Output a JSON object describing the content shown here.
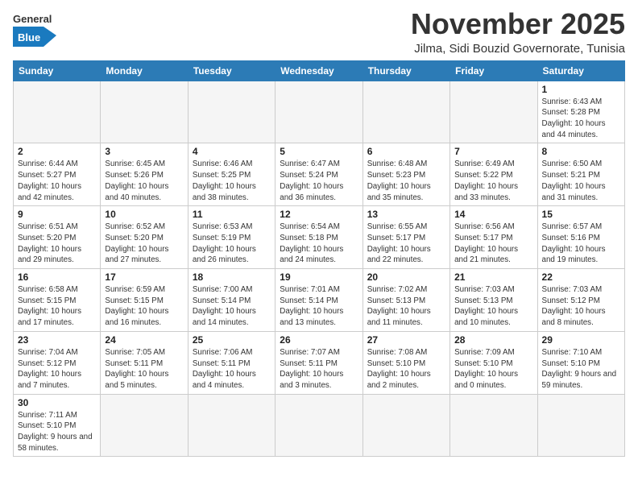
{
  "header": {
    "logo_general": "General",
    "logo_blue": "Blue",
    "month_title": "November 2025",
    "location": "Jilma, Sidi Bouzid Governorate, Tunisia"
  },
  "weekdays": [
    "Sunday",
    "Monday",
    "Tuesday",
    "Wednesday",
    "Thursday",
    "Friday",
    "Saturday"
  ],
  "weeks": [
    [
      {
        "day": "",
        "info": ""
      },
      {
        "day": "",
        "info": ""
      },
      {
        "day": "",
        "info": ""
      },
      {
        "day": "",
        "info": ""
      },
      {
        "day": "",
        "info": ""
      },
      {
        "day": "",
        "info": ""
      },
      {
        "day": "1",
        "info": "Sunrise: 6:43 AM\nSunset: 5:28 PM\nDaylight: 10 hours and 44 minutes."
      }
    ],
    [
      {
        "day": "2",
        "info": "Sunrise: 6:44 AM\nSunset: 5:27 PM\nDaylight: 10 hours and 42 minutes."
      },
      {
        "day": "3",
        "info": "Sunrise: 6:45 AM\nSunset: 5:26 PM\nDaylight: 10 hours and 40 minutes."
      },
      {
        "day": "4",
        "info": "Sunrise: 6:46 AM\nSunset: 5:25 PM\nDaylight: 10 hours and 38 minutes."
      },
      {
        "day": "5",
        "info": "Sunrise: 6:47 AM\nSunset: 5:24 PM\nDaylight: 10 hours and 36 minutes."
      },
      {
        "day": "6",
        "info": "Sunrise: 6:48 AM\nSunset: 5:23 PM\nDaylight: 10 hours and 35 minutes."
      },
      {
        "day": "7",
        "info": "Sunrise: 6:49 AM\nSunset: 5:22 PM\nDaylight: 10 hours and 33 minutes."
      },
      {
        "day": "8",
        "info": "Sunrise: 6:50 AM\nSunset: 5:21 PM\nDaylight: 10 hours and 31 minutes."
      }
    ],
    [
      {
        "day": "9",
        "info": "Sunrise: 6:51 AM\nSunset: 5:20 PM\nDaylight: 10 hours and 29 minutes."
      },
      {
        "day": "10",
        "info": "Sunrise: 6:52 AM\nSunset: 5:20 PM\nDaylight: 10 hours and 27 minutes."
      },
      {
        "day": "11",
        "info": "Sunrise: 6:53 AM\nSunset: 5:19 PM\nDaylight: 10 hours and 26 minutes."
      },
      {
        "day": "12",
        "info": "Sunrise: 6:54 AM\nSunset: 5:18 PM\nDaylight: 10 hours and 24 minutes."
      },
      {
        "day": "13",
        "info": "Sunrise: 6:55 AM\nSunset: 5:17 PM\nDaylight: 10 hours and 22 minutes."
      },
      {
        "day": "14",
        "info": "Sunrise: 6:56 AM\nSunset: 5:17 PM\nDaylight: 10 hours and 21 minutes."
      },
      {
        "day": "15",
        "info": "Sunrise: 6:57 AM\nSunset: 5:16 PM\nDaylight: 10 hours and 19 minutes."
      }
    ],
    [
      {
        "day": "16",
        "info": "Sunrise: 6:58 AM\nSunset: 5:15 PM\nDaylight: 10 hours and 17 minutes."
      },
      {
        "day": "17",
        "info": "Sunrise: 6:59 AM\nSunset: 5:15 PM\nDaylight: 10 hours and 16 minutes."
      },
      {
        "day": "18",
        "info": "Sunrise: 7:00 AM\nSunset: 5:14 PM\nDaylight: 10 hours and 14 minutes."
      },
      {
        "day": "19",
        "info": "Sunrise: 7:01 AM\nSunset: 5:14 PM\nDaylight: 10 hours and 13 minutes."
      },
      {
        "day": "20",
        "info": "Sunrise: 7:02 AM\nSunset: 5:13 PM\nDaylight: 10 hours and 11 minutes."
      },
      {
        "day": "21",
        "info": "Sunrise: 7:03 AM\nSunset: 5:13 PM\nDaylight: 10 hours and 10 minutes."
      },
      {
        "day": "22",
        "info": "Sunrise: 7:03 AM\nSunset: 5:12 PM\nDaylight: 10 hours and 8 minutes."
      }
    ],
    [
      {
        "day": "23",
        "info": "Sunrise: 7:04 AM\nSunset: 5:12 PM\nDaylight: 10 hours and 7 minutes."
      },
      {
        "day": "24",
        "info": "Sunrise: 7:05 AM\nSunset: 5:11 PM\nDaylight: 10 hours and 5 minutes."
      },
      {
        "day": "25",
        "info": "Sunrise: 7:06 AM\nSunset: 5:11 PM\nDaylight: 10 hours and 4 minutes."
      },
      {
        "day": "26",
        "info": "Sunrise: 7:07 AM\nSunset: 5:11 PM\nDaylight: 10 hours and 3 minutes."
      },
      {
        "day": "27",
        "info": "Sunrise: 7:08 AM\nSunset: 5:10 PM\nDaylight: 10 hours and 2 minutes."
      },
      {
        "day": "28",
        "info": "Sunrise: 7:09 AM\nSunset: 5:10 PM\nDaylight: 10 hours and 0 minutes."
      },
      {
        "day": "29",
        "info": "Sunrise: 7:10 AM\nSunset: 5:10 PM\nDaylight: 9 hours and 59 minutes."
      }
    ],
    [
      {
        "day": "30",
        "info": "Sunrise: 7:11 AM\nSunset: 5:10 PM\nDaylight: 9 hours and 58 minutes."
      },
      {
        "day": "",
        "info": ""
      },
      {
        "day": "",
        "info": ""
      },
      {
        "day": "",
        "info": ""
      },
      {
        "day": "",
        "info": ""
      },
      {
        "day": "",
        "info": ""
      },
      {
        "day": "",
        "info": ""
      }
    ]
  ],
  "colors": {
    "header_bg": "#2c7bb6",
    "logo_blue": "#1a7abf"
  }
}
